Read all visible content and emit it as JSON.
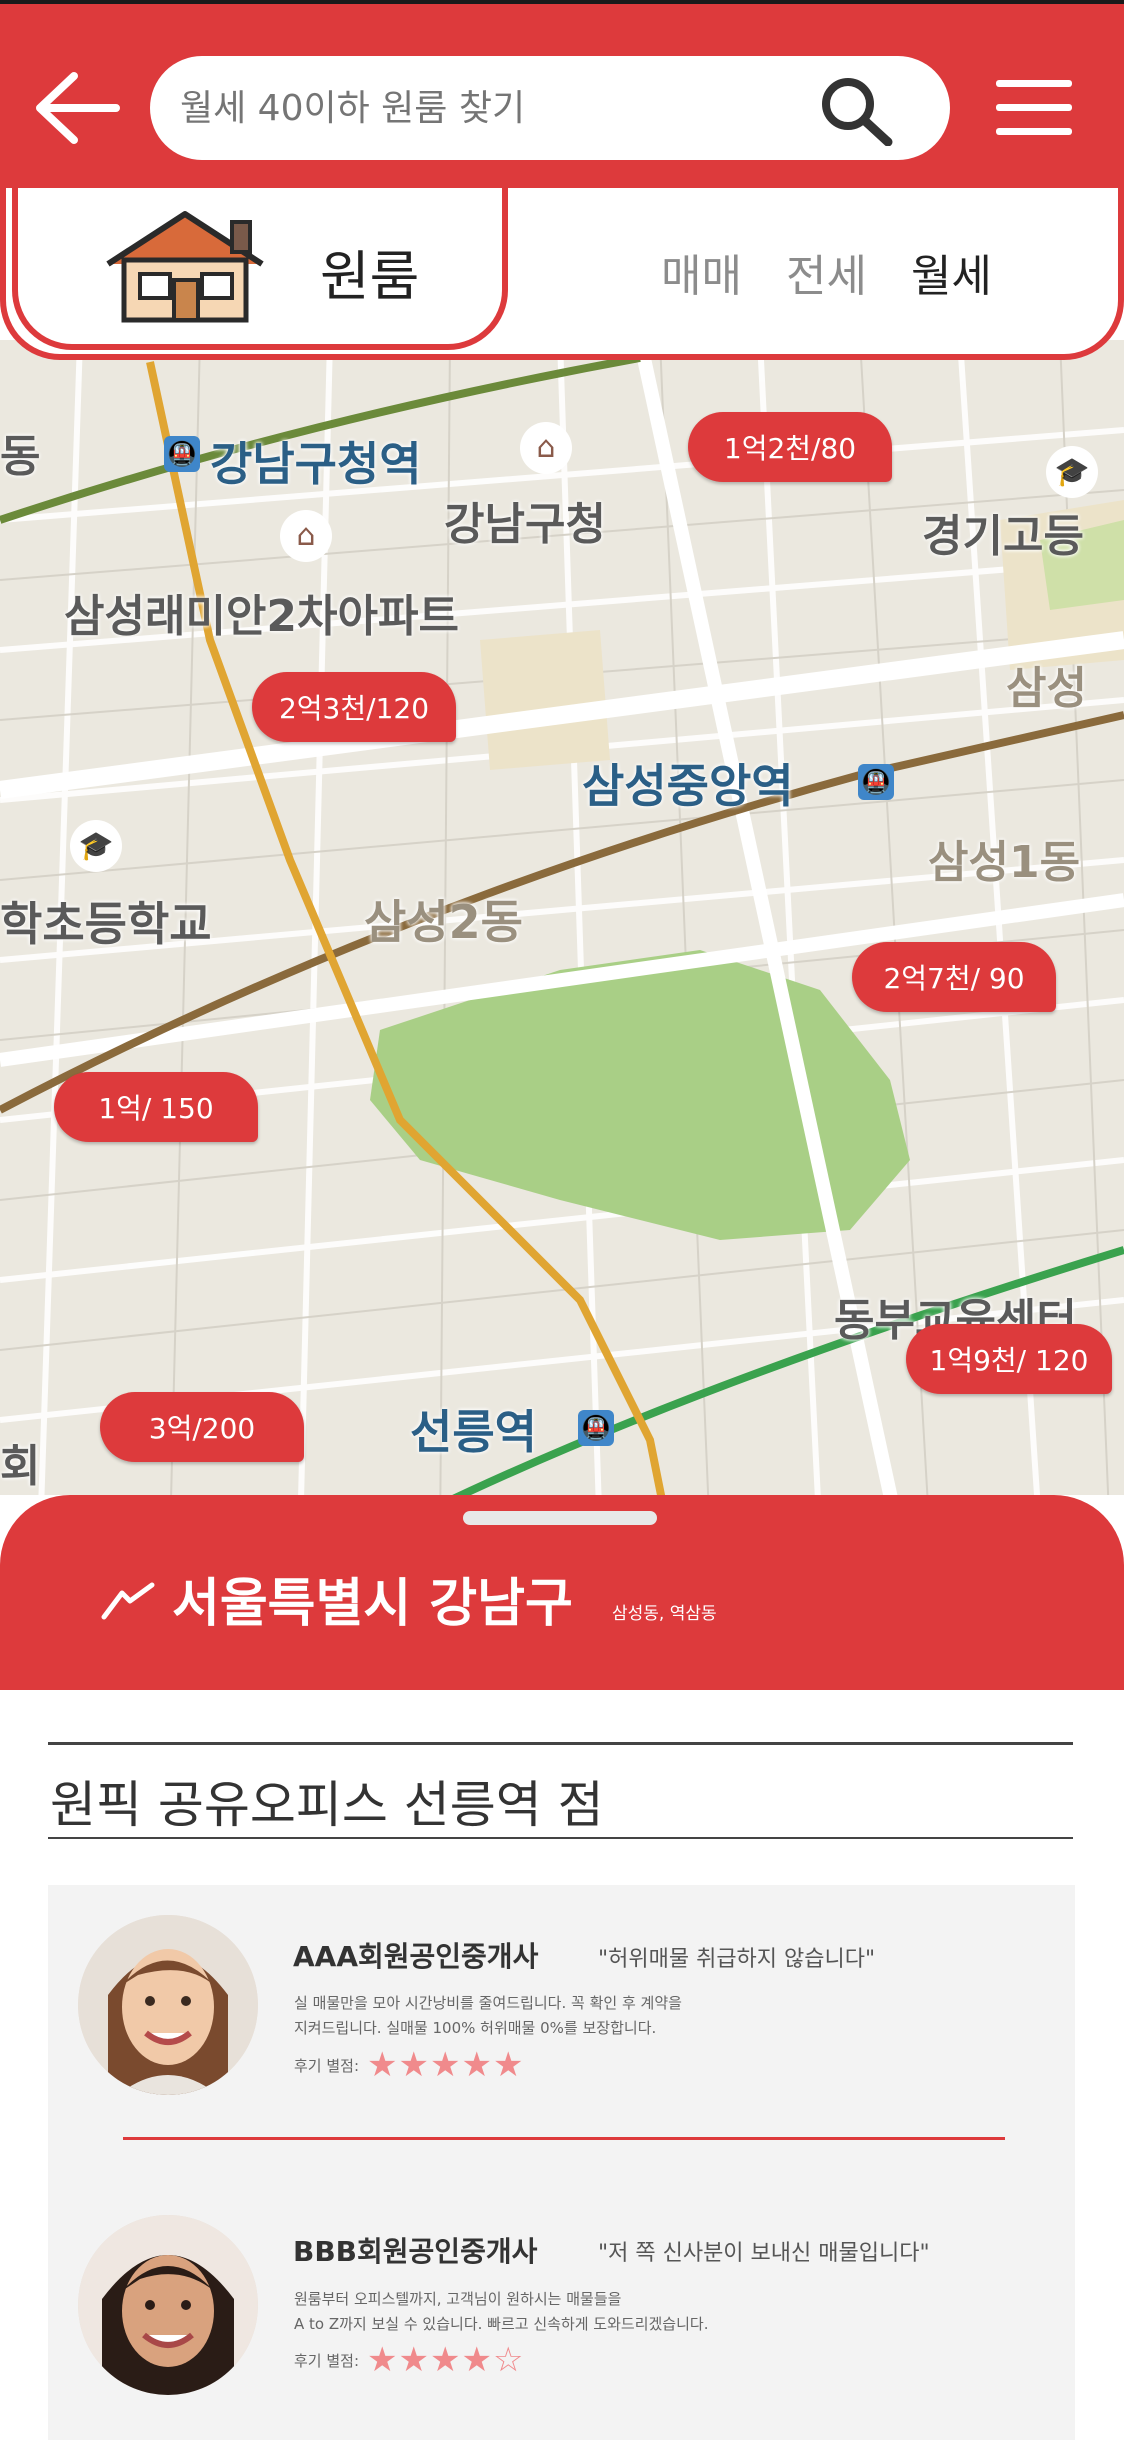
{
  "header": {
    "search_placeholder": "월세 40이하 원룸 찾기"
  },
  "category": {
    "label": "원룸",
    "types": [
      "매매",
      "전세",
      "월세"
    ],
    "active_type": "월세"
  },
  "map": {
    "places": {
      "gangnam_office_station": "강남구청역",
      "gangnam_office": "강남구청",
      "raemian": "삼성래미안2차아파트",
      "samsung_central_station": "삼성중앙역",
      "gyeonggi_high": "경기고등",
      "samsung": "삼성",
      "samsung1": "삼성1동",
      "school": "학초등학교",
      "samsung2": "삼성2동",
      "dongbu": "동부교육센터",
      "seolleung_station": "선릉역",
      "edge_left": "회",
      "edge_topleft": "동"
    },
    "pins": [
      "1억2천/80",
      "2억3천/120",
      "2억7천/ 90",
      "1억/ 150",
      "1억9천/ 120",
      "3억/200"
    ]
  },
  "sheet": {
    "region": "서울특별시 강남구",
    "region_sub": "삼성동, 역삼동",
    "office_title": "원픽 공유오피스 선릉역 점",
    "agents": [
      {
        "name": "AAA회원공인중개사",
        "quote": "\"허위매물 취급하지 않습니다\"",
        "desc1": "실 매물만을 모아 시간낭비를 줄여드립니다. 꼭 확인 후 계약을",
        "desc2": "지켜드립니다. 실매물 100% 허위매물 0%를 보장합니다.",
        "rating_label": "후기 별점:",
        "stars": "★★★★★",
        "rating": 5
      },
      {
        "name": "BBB회원공인중개사",
        "quote": "\"저 쪽 신사분이 보내신 매물입니다\"",
        "desc1": "원룸부터 오피스텔까지, 고객님이 원하시는 매물들을",
        "desc2": "A to Z까지 보실 수 있습니다. 빠르고 신속하게 도와드리겠습니다.",
        "rating_label": "후기 별점:",
        "stars": "★★★★☆",
        "rating": 4
      }
    ]
  },
  "colors": {
    "brand_red": "#dd3a3c",
    "star_pink": "#f08a8c"
  },
  "icons": [
    "back-arrow-icon",
    "search-icon",
    "hamburger-menu-icon",
    "house-icon",
    "location-trend-icon",
    "subway-icon",
    "school-icon",
    "building-icon"
  ]
}
